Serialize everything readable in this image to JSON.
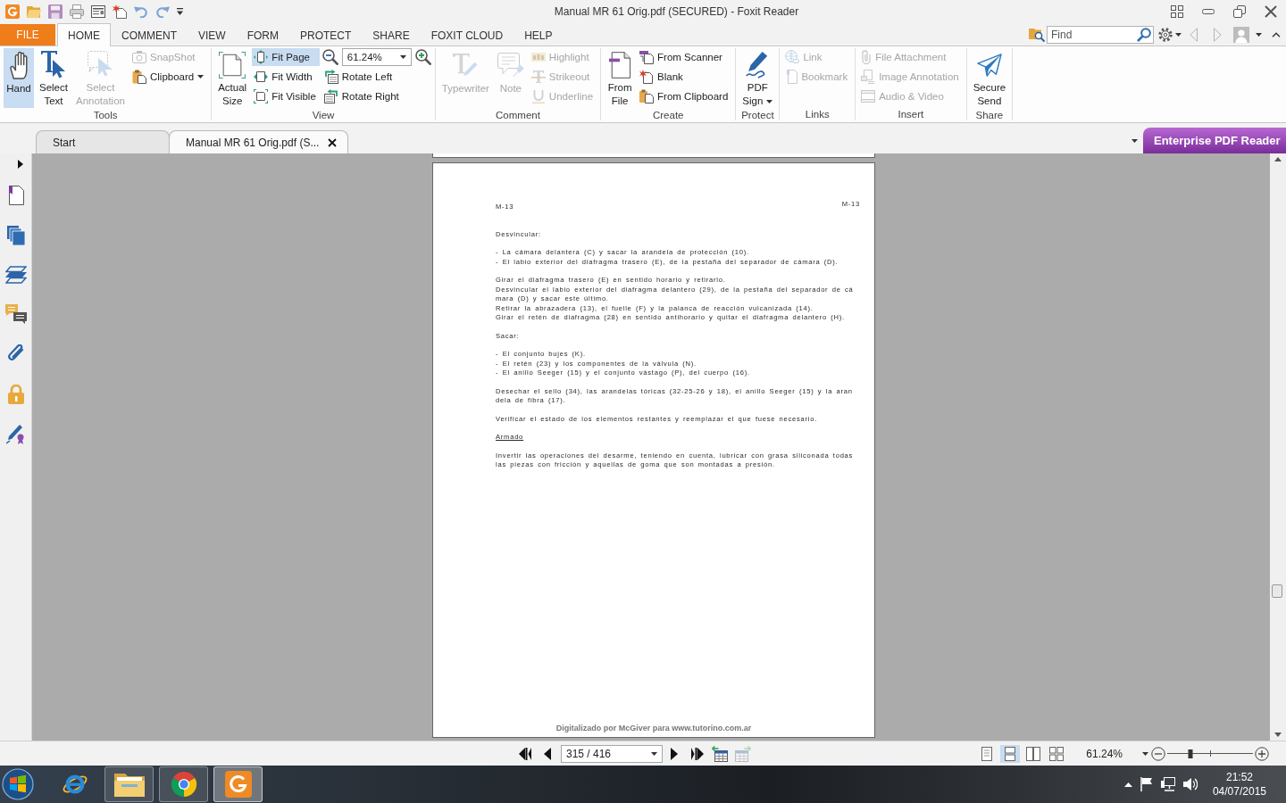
{
  "window": {
    "title": "Manual MR 61 Orig.pdf (SECURED) - Foxit Reader"
  },
  "menu_tabs": [
    {
      "label": "FILE",
      "kind": "file",
      "selected": false
    },
    {
      "label": "HOME",
      "kind": "tab",
      "selected": true
    },
    {
      "label": "COMMENT",
      "kind": "tab",
      "selected": false
    },
    {
      "label": "VIEW",
      "kind": "tab",
      "selected": false
    },
    {
      "label": "FORM",
      "kind": "tab",
      "selected": false
    },
    {
      "label": "PROTECT",
      "kind": "tab",
      "selected": false
    },
    {
      "label": "SHARE",
      "kind": "tab",
      "selected": false
    },
    {
      "label": "FOXIT CLOUD",
      "kind": "tab",
      "selected": false
    },
    {
      "label": "HELP",
      "kind": "tab",
      "selected": false
    }
  ],
  "search": {
    "placeholder": "Find"
  },
  "ribbon": {
    "groups": [
      {
        "label": "Tools",
        "items": [
          {
            "kind": "large",
            "label": "Hand",
            "selected": true,
            "disabled": false,
            "dropdown": false
          },
          {
            "kind": "large",
            "label": "Select Text",
            "selected": false,
            "disabled": false,
            "dropdown": false
          },
          {
            "kind": "large",
            "label": "Select Annotation",
            "selected": false,
            "disabled": true,
            "dropdown": false
          },
          {
            "kind": "small",
            "label": "SnapShot",
            "selected": false,
            "disabled": true,
            "dropdown": false
          },
          {
            "kind": "small",
            "label": "Clipboard",
            "selected": false,
            "disabled": false,
            "dropdown": true
          }
        ]
      },
      {
        "label": "View",
        "items": [
          {
            "kind": "large",
            "label": "Actual Size",
            "selected": false,
            "disabled": false,
            "dropdown": false
          },
          {
            "kind": "small",
            "label": "Fit Page",
            "selected": true,
            "disabled": false,
            "dropdown": false
          },
          {
            "kind": "small",
            "label": "Fit Width",
            "selected": false,
            "disabled": false,
            "dropdown": false
          },
          {
            "kind": "small",
            "label": "Fit Visible",
            "selected": false,
            "disabled": false,
            "dropdown": false
          },
          {
            "kind": "zoom",
            "value": "61.24%",
            "selected": false,
            "disabled": false,
            "dropdown": true
          },
          {
            "kind": "small",
            "label": "Rotate Left",
            "selected": false,
            "disabled": false,
            "dropdown": false
          },
          {
            "kind": "small",
            "label": "Rotate Right",
            "selected": false,
            "disabled": false,
            "dropdown": false
          }
        ]
      },
      {
        "label": "Comment",
        "items": [
          {
            "kind": "large",
            "label": "Typewriter",
            "selected": false,
            "disabled": true,
            "dropdown": false
          },
          {
            "kind": "large",
            "label": "Note",
            "selected": false,
            "disabled": true,
            "dropdown": false
          },
          {
            "kind": "small",
            "label": "Highlight",
            "selected": false,
            "disabled": true,
            "dropdown": false
          },
          {
            "kind": "small",
            "label": "Strikeout",
            "selected": false,
            "disabled": true,
            "dropdown": false
          },
          {
            "kind": "small",
            "label": "Underline",
            "selected": false,
            "disabled": true,
            "dropdown": false
          }
        ]
      },
      {
        "label": "Create",
        "items": [
          {
            "kind": "large",
            "label": "From File",
            "selected": false,
            "disabled": false,
            "dropdown": false
          },
          {
            "kind": "small",
            "label": "From Scanner",
            "selected": false,
            "disabled": false,
            "dropdown": false
          },
          {
            "kind": "small",
            "label": "Blank",
            "selected": false,
            "disabled": false,
            "dropdown": false
          },
          {
            "kind": "small",
            "label": "From Clipboard",
            "selected": false,
            "disabled": false,
            "dropdown": false
          }
        ]
      },
      {
        "label": "Protect",
        "items": [
          {
            "kind": "large",
            "label": "PDF Sign",
            "selected": false,
            "disabled": false,
            "dropdown": true
          }
        ]
      },
      {
        "label": "Links",
        "items": [
          {
            "kind": "small",
            "label": "Link",
            "selected": false,
            "disabled": true,
            "dropdown": false
          },
          {
            "kind": "small",
            "label": "Bookmark",
            "selected": false,
            "disabled": true,
            "dropdown": false
          }
        ]
      },
      {
        "label": "Insert",
        "items": [
          {
            "kind": "small",
            "label": "File Attachment",
            "selected": false,
            "disabled": true,
            "dropdown": false
          },
          {
            "kind": "small",
            "label": "Image Annotation",
            "selected": false,
            "disabled": true,
            "dropdown": false
          },
          {
            "kind": "small",
            "label": "Audio & Video",
            "selected": false,
            "disabled": true,
            "dropdown": false
          }
        ]
      },
      {
        "label": "Share",
        "items": [
          {
            "kind": "large",
            "label": "Secure Send",
            "selected": false,
            "disabled": false,
            "dropdown": false
          }
        ]
      }
    ]
  },
  "document_tabs": [
    {
      "label": "Start",
      "selected": false,
      "closable": false
    },
    {
      "label": "Manual MR 61 Orig.pdf (S...",
      "selected": true,
      "closable": true
    }
  ],
  "promo": {
    "label": "Enterprise PDF Reader"
  },
  "page": {
    "header_left": "M-13",
    "header_right": "M-13",
    "blocks": [
      {
        "kind": "label",
        "lines": [
          "Desvincular:"
        ]
      },
      {
        "kind": "list",
        "lines": [
          "- La cámara delantera (C) y sacar la arandela de protección (10).",
          "- El labio exterior del diafragma trasero (E), de la pestaña del separador de cámara (D)."
        ]
      },
      {
        "kind": "paragraph",
        "lines": [
          "Girar el diafragma trasero (E) en sentido horario y retirarlo.",
          "Desvincular el labio exterior del diafragma delantero (29), de la pestaña del separador de cá",
          "mara (D) y sacar este último.",
          "Retirar la abrazadera (13), el fuelle (F) y la palanca de reacción vulcanizada (14).",
          "Girar el retén de diafragma (28) en sentido antihorario y quitar el diafragma delantero (H)."
        ]
      },
      {
        "kind": "label",
        "lines": [
          "Sacar:"
        ]
      },
      {
        "kind": "list",
        "lines": [
          "- El conjunto bujes (K).",
          "- El retén (23) y los componentes de la válvula (N).",
          "- El anillo Seeger (15) y el conjunto vástago (P), del cuerpo (16)."
        ]
      },
      {
        "kind": "paragraph",
        "lines": [
          "Desechar el sello (34), las arandelas tóricas (32-25-26 y 18), el anillo Seeger (15) y la aran",
          "dela de fibra (17)."
        ]
      },
      {
        "kind": "paragraph",
        "lines": [
          "Verificar el estado de los elementos restantes y reemplazar el que fuese necesario."
        ]
      },
      {
        "kind": "heading",
        "lines": [
          "Armado"
        ]
      },
      {
        "kind": "paragraph",
        "lines": [
          "Invertir las operaciones del desarme, teniendo en cuenta, lubricar con grasa siliconada todas",
          "las piezas con fricción y aquellas de goma que son montadas a presión."
        ]
      }
    ],
    "footer": "Digitalizado por McGiver para www.tutorino.com.ar"
  },
  "status_bar": {
    "page_field": {
      "value": "315 / 416"
    },
    "tools": [
      {
        "disabled": false
      },
      {
        "disabled": true
      }
    ],
    "view_modes": [
      {
        "selected": false
      },
      {
        "selected": true
      },
      {
        "selected": false
      },
      {
        "selected": false
      }
    ],
    "zoom": {
      "value": "61.24%"
    },
    "zoom_slider": {
      "level": 0.27
    }
  },
  "taskbar": {
    "apps": [
      {
        "running": false,
        "selected": false
      },
      {
        "running": true,
        "selected": false
      },
      {
        "running": true,
        "selected": false
      },
      {
        "running": true,
        "selected": true
      }
    ],
    "clock": {
      "time": "21:52",
      "date": "04/07/2015"
    }
  }
}
